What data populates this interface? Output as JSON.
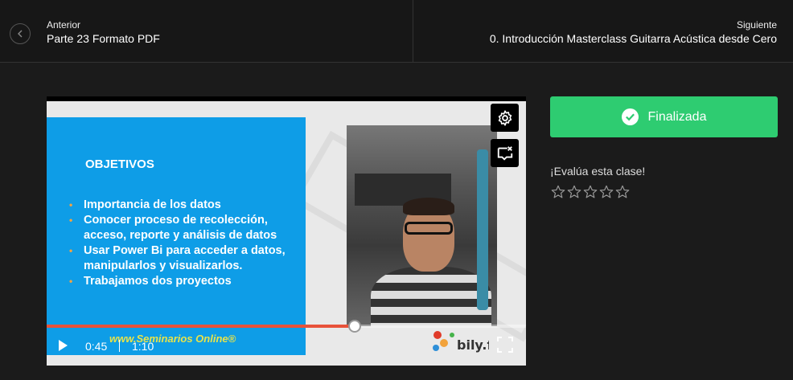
{
  "nav": {
    "prev_label": "Anterior",
    "prev_title": "Parte 23 Formato PDF",
    "next_label": "Siguiente",
    "next_title": "0. Introducción Masterclass Guitarra Acústica desde Cero"
  },
  "slide": {
    "heading": "OBJETIVOS",
    "bullets": [
      "Importancia de los datos",
      "Conocer proceso de recolección, acceso, reporte y análisis de datos",
      "Usar Power Bi para acceder a datos, manipularlos y visualizarlos.",
      "Trabajamos dos proyectos"
    ],
    "watermark": "www.Seminarios Online®"
  },
  "player": {
    "current_time": "0:45",
    "duration": "1:10",
    "progress_fraction": 0.643,
    "logo_text": "bily.fob"
  },
  "sidebar": {
    "finish_label": "Finalizada",
    "rate_label": "¡Evalúa esta clase!",
    "stars_total": 5,
    "stars_filled": 0
  },
  "colors": {
    "accent_green": "#2ecc71",
    "progress_red": "#e8523a",
    "slide_blue": "#0e9de7",
    "bullet_orange": "#f4a340"
  }
}
